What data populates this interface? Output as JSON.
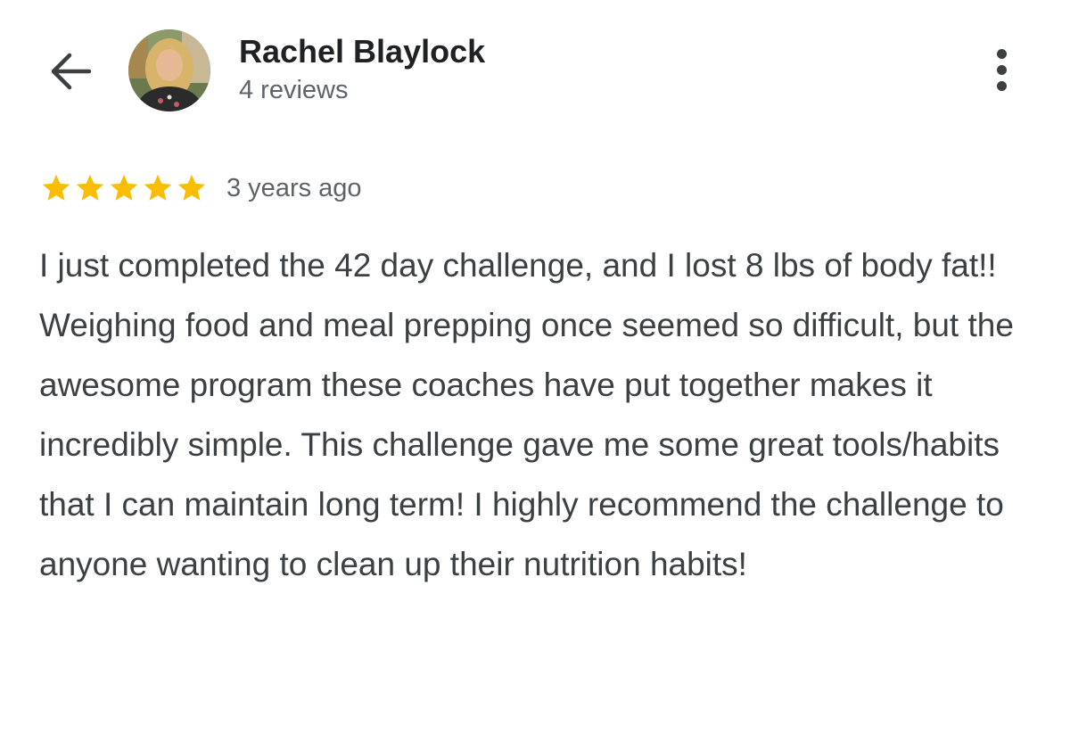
{
  "header": {
    "back_icon": "arrow-left-icon",
    "reviewer_name": "Rachel Blaylock",
    "reviewer_subtitle": "4 reviews",
    "more_icon": "more-vertical-icon"
  },
  "review": {
    "rating": 5,
    "rating_max": 5,
    "star_color": "#fbbc04",
    "time_ago": "3 years ago",
    "text": "I just completed the 42 day challenge, and I lost 8 lbs of body fat!! Weighing food and meal prepping once seemed so difficult, but the awesome program these coaches have put together makes it incredibly simple. This challenge gave me some great tools/habits that I can maintain long term! I highly recommend the challenge to anyone wanting to clean up their nutrition habits!"
  }
}
